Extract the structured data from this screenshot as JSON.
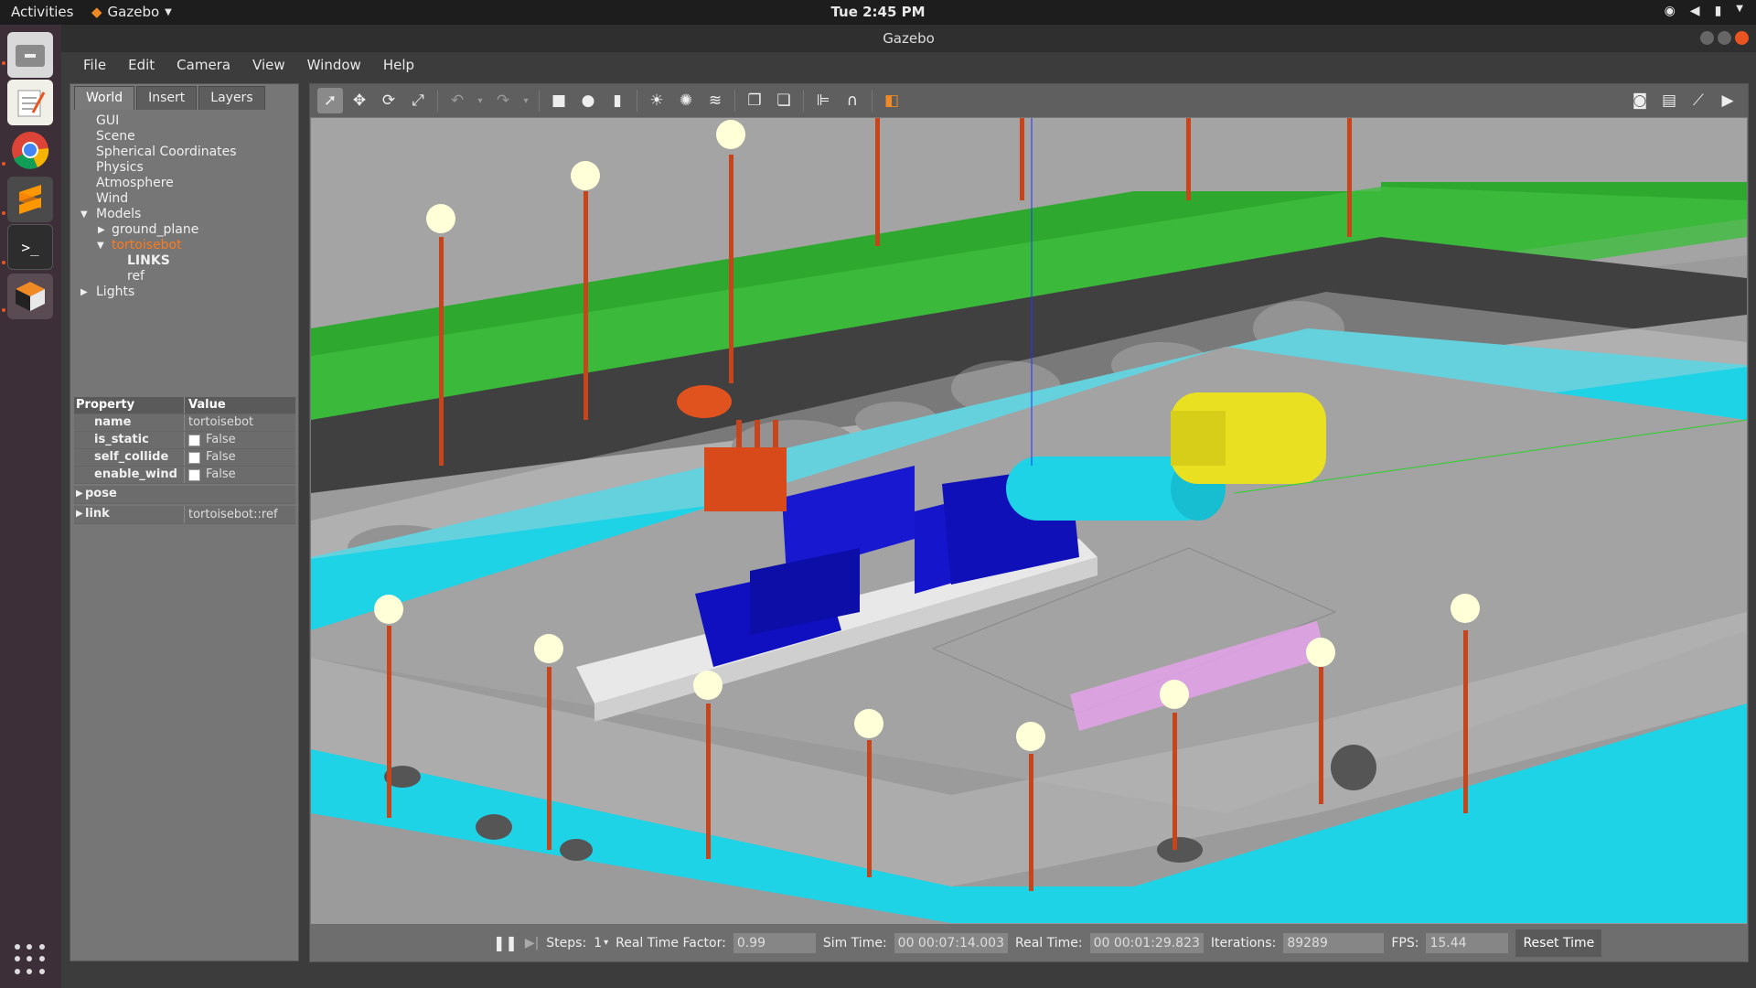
{
  "topbar": {
    "activities": "Activities",
    "app_name": "Gazebo",
    "clock": "Tue  2:45 PM"
  },
  "window": {
    "title": "Gazebo"
  },
  "menu": [
    "File",
    "Edit",
    "Camera",
    "View",
    "Window",
    "Help"
  ],
  "left_tabs": [
    "World",
    "Insert",
    "Layers"
  ],
  "tree": {
    "gui": "GUI",
    "scene": "Scene",
    "spherical": "Spherical Coordinates",
    "physics": "Physics",
    "atmosphere": "Atmosphere",
    "wind": "Wind",
    "models": "Models",
    "ground_plane": "ground_plane",
    "tortoisebot": "tortoisebot",
    "links": "LINKS",
    "ref": "ref",
    "lights": "Lights"
  },
  "properties": {
    "col_property": "Property",
    "col_value": "Value",
    "rows": [
      {
        "key": "name",
        "value": "tortoisebot"
      },
      {
        "key": "is_static",
        "value": "False"
      },
      {
        "key": "self_collide",
        "value": "False"
      },
      {
        "key": "enable_wind",
        "value": "False"
      }
    ],
    "pose": "pose",
    "link": "link",
    "link_value": "tortoisebot::ref"
  },
  "bottom": {
    "steps_label": "Steps:",
    "steps_value": "1",
    "rtf_label": "Real Time Factor:",
    "rtf_value": "0.99",
    "sim_label": "Sim Time:",
    "sim_value": "00 00:07:14.003",
    "real_label": "Real Time:",
    "real_value": "00 00:01:29.823",
    "iter_label": "Iterations:",
    "iter_value": "89289",
    "fps_label": "FPS:",
    "fps_value": "15.44",
    "reset_label": "Reset Time"
  },
  "colors": {
    "accent": "#e95420",
    "selected_model": "#ff7a1a"
  }
}
